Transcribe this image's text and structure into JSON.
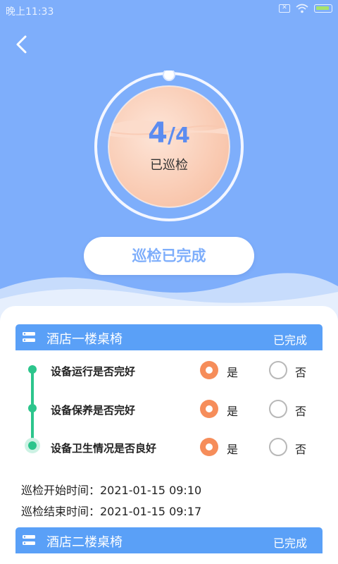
{
  "status_bar": {
    "time": "晚上11:33",
    "icons": [
      "sim-x-icon",
      "wifi-icon",
      "battery-charging-icon"
    ]
  },
  "header": {
    "back_icon": "chevron-left-icon",
    "progress": {
      "done": "4",
      "separator": "/",
      "total": "4",
      "label": "已巡检",
      "fraction": 1.0
    },
    "button_label": "巡检已完成"
  },
  "cards": [
    {
      "title": "酒店一楼桌椅",
      "status": "已完成",
      "icon": "list-icon",
      "items": [
        {
          "question": "设备运行是否完好",
          "yes_label": "是",
          "no_label": "否",
          "selected": "是"
        },
        {
          "question": "设备保养是否完好",
          "yes_label": "是",
          "no_label": "否",
          "selected": "是"
        },
        {
          "question": "设备卫生情况是否良好",
          "yes_label": "是",
          "no_label": "否",
          "selected": "是"
        }
      ],
      "start_time": "巡检开始时间：2021-01-15 09:10",
      "end_time": "巡检结束时间：2021-01-15 09:17"
    },
    {
      "title": "酒店二楼桌椅",
      "status": "已完成",
      "icon": "list-icon"
    }
  ],
  "colors": {
    "hero_bg": "#7eaefb",
    "card_header": "#5aa0f7",
    "radio_selected": "#f68d5a",
    "timeline": "#2cc58c",
    "ball_fill": "#fbd1bd"
  }
}
